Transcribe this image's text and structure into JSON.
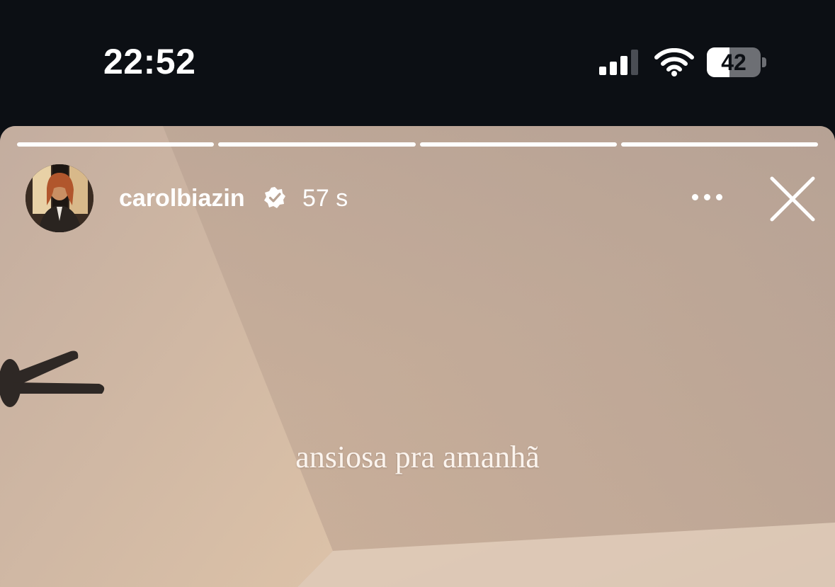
{
  "status_bar": {
    "time": "22:52",
    "battery_level": "42",
    "battery_fraction": 0.42,
    "signal_bars_active": 3,
    "icons": [
      "cellular-signal-icon",
      "wifi-icon",
      "battery-icon"
    ]
  },
  "story": {
    "segments": [
      {
        "progress": 1.0
      },
      {
        "progress": 1.0
      },
      {
        "progress": 1.0
      },
      {
        "progress": 1.0
      }
    ],
    "username": "carolbiazin",
    "verified": true,
    "time_ago": "57 s",
    "caption": "ansiosa pra amanhã",
    "icons": {
      "verified": "verified-badge-icon",
      "more": "more-options-icon",
      "close": "close-icon"
    }
  },
  "colors": {
    "status_bar_bg": "#0c0f14",
    "story_bg": "#d2baa3",
    "text": "#ffffff"
  }
}
